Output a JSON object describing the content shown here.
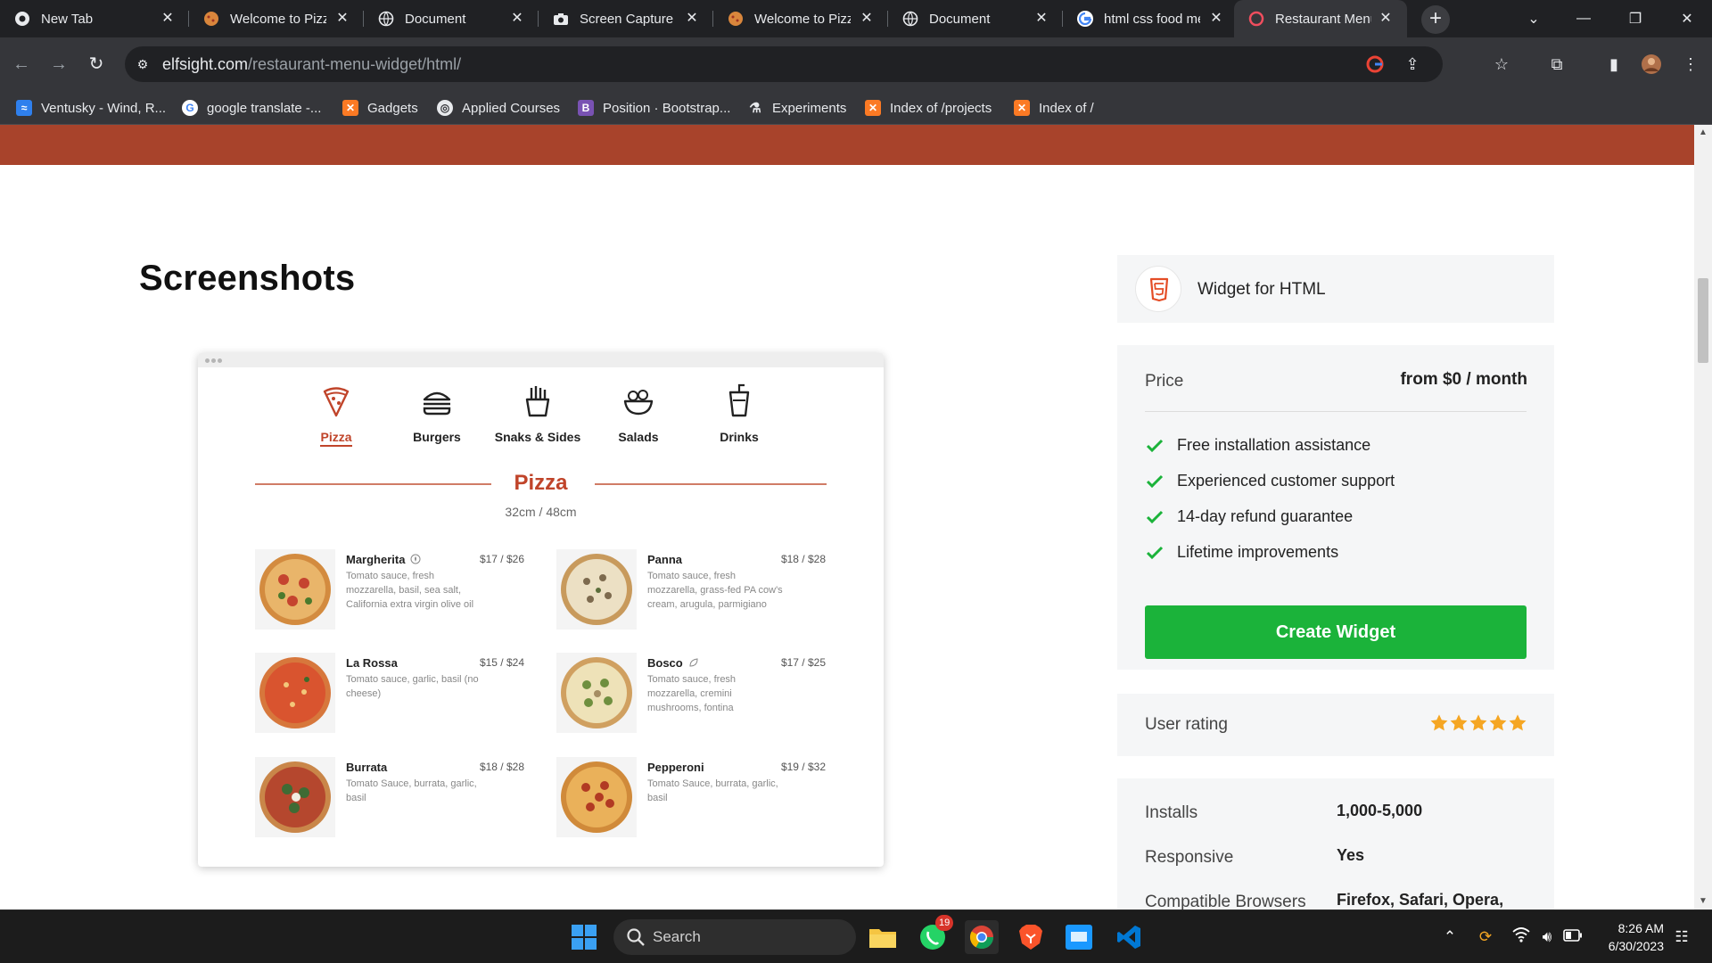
{
  "browser": {
    "tabs": [
      {
        "title": "New Tab",
        "icon": "chrome-icon"
      },
      {
        "title": "Welcome to Pizza",
        "icon": "pizza-favicon-icon"
      },
      {
        "title": "Document",
        "icon": "globe-icon"
      },
      {
        "title": "Screen Capture",
        "icon": "camera-icon"
      },
      {
        "title": "Welcome to Pizza",
        "icon": "pizza-favicon-icon"
      },
      {
        "title": "Document",
        "icon": "globe-icon"
      },
      {
        "title": "html css food menu",
        "icon": "google-icon"
      },
      {
        "title": "Restaurant Menu",
        "icon": "elfsight-icon",
        "active": true
      }
    ],
    "address": {
      "host": "elfsight.com",
      "path": "/restaurant-menu-widget/html/"
    },
    "bookmarks": [
      {
        "label": "Ventusky - Wind, R...",
        "icon": "ventusky-icon"
      },
      {
        "label": "google translate -...",
        "icon": "google-icon"
      },
      {
        "label": "Gadgets",
        "icon": "xampp-icon"
      },
      {
        "label": "Applied Courses",
        "icon": "globe-icon"
      },
      {
        "label": "Position · Bootstrap...",
        "icon": "bootstrap-icon"
      },
      {
        "label": "Experiments",
        "icon": "flask-icon"
      },
      {
        "label": "Index of /projects",
        "icon": "xampp-icon"
      },
      {
        "label": "Index of /",
        "icon": "xampp-icon"
      }
    ]
  },
  "page": {
    "section_title": "Screenshots",
    "widget_preview": {
      "categories": [
        {
          "label": "Pizza",
          "icon": "pizza-icon",
          "active": true
        },
        {
          "label": "Burgers",
          "icon": "burger-icon"
        },
        {
          "label": "Snaks & Sides",
          "icon": "fries-icon"
        },
        {
          "label": "Salads",
          "icon": "salad-icon"
        },
        {
          "label": "Drinks",
          "icon": "drink-icon"
        }
      ],
      "menu_title": "Pizza",
      "menu_subtitle": "32cm / 48cm",
      "dishes": [
        {
          "name": "Margherita",
          "price": "$17 / $26",
          "desc": "Tomato sauce, fresh mozzarella, basil, sea salt, California extra virgin olive oil",
          "veg": true
        },
        {
          "name": "Panna",
          "price": "$18 / $28",
          "desc": "Tomato sauce, fresh mozzarella, grass-fed PA cow's cream, arugula, parmigiano"
        },
        {
          "name": "La Rossa",
          "price": "$15 / $24",
          "desc": "Tomato sauce, garlic, basil (no cheese)"
        },
        {
          "name": "Bosco",
          "price": "$17 / $25",
          "desc": "Tomato sauce, fresh mozzarella, cremini mushrooms, fontina",
          "veg": true
        },
        {
          "name": "Burrata",
          "price": "$18 / $28",
          "desc": "Tomato Sauce, burrata, garlic, basil"
        },
        {
          "name": "Pepperoni",
          "price": "$19 / $32",
          "desc": "Tomato Sauce, burrata, garlic, basil"
        }
      ]
    },
    "sidebar": {
      "widget_for": "Widget for HTML",
      "price_label": "Price",
      "price_value": "from $0 / month",
      "features": [
        "Free installation assistance",
        "Experienced customer support",
        "14-day refund guarantee",
        "Lifetime improvements"
      ],
      "cta_label": "Create Widget",
      "rating_label": "User rating",
      "rating_stars": 5,
      "info": [
        {
          "key": "Installs",
          "value": "1,000-5,000"
        },
        {
          "key": "Responsive",
          "value": "Yes"
        },
        {
          "key": "Compatible Browsers",
          "value": "Firefox, Safari, Opera,"
        }
      ]
    }
  },
  "taskbar": {
    "search_placeholder": "Search",
    "whatsapp_badge": "19",
    "time": "8:26 AM",
    "date": "6/30/2023"
  },
  "colors": {
    "accent": "#c0442a",
    "banner": "#a8432b",
    "cta": "#1bb33a",
    "check": "#1bb33a",
    "star": "#f5a623"
  }
}
